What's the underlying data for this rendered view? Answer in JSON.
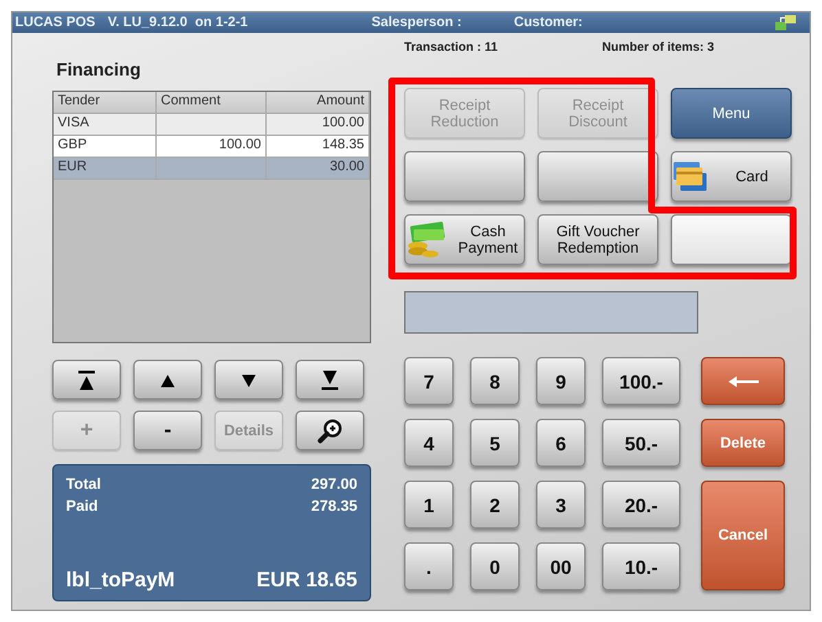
{
  "title_bar": {
    "app": "LUCAS POS",
    "version": "V. LU_9.12.0  on 1-2-1",
    "salesperson": "Salesperson :",
    "customer": "Customer:"
  },
  "financing": {
    "title": "Financing",
    "columns": [
      "Tender",
      "Comment",
      "Amount"
    ],
    "rows": [
      {
        "cells": [
          "VISA",
          "",
          "100.00"
        ],
        "selected": false
      },
      {
        "cells": [
          "GBP",
          "100.00",
          "148.35"
        ],
        "selected": false
      },
      {
        "cells": [
          "EUR",
          "",
          "30.00"
        ],
        "selected": true
      }
    ]
  },
  "nav_buttons": [
    {
      "kind": "first",
      "disabled": false
    },
    {
      "kind": "up",
      "disabled": false
    },
    {
      "kind": "down",
      "disabled": false
    },
    {
      "kind": "last",
      "disabled": false
    },
    {
      "kind": "text",
      "label": "+",
      "disabled": true
    },
    {
      "kind": "text",
      "label": "-",
      "disabled": false
    },
    {
      "kind": "text",
      "label": "Details",
      "disabled": true
    },
    {
      "kind": "zoom",
      "disabled": false
    }
  ],
  "totals": {
    "rows": [
      {
        "label": "Total",
        "value": "297.00"
      },
      {
        "label": "Paid",
        "value": "278.35"
      }
    ],
    "due_label": "lbl_toPayM",
    "due_value": "EUR 18.65"
  },
  "transaction": "Transaction : 11",
  "item_count": "Number of items: 3",
  "function_buttons": [
    {
      "label": "Receipt\nReduction",
      "kind": "gray",
      "disabled": true
    },
    {
      "label": "Receipt\nDiscount",
      "kind": "gray",
      "disabled": true
    },
    {
      "label": "Menu",
      "kind": "blue",
      "disabled": false
    },
    {
      "kind": "gray",
      "disabled": false
    },
    {
      "kind": "gray",
      "disabled": false
    },
    {
      "label": "Card",
      "kind": "card",
      "disabled": false
    },
    {
      "label": "Cash\nPayment",
      "kind": "cash",
      "disabled": false
    },
    {
      "label": "Gift Voucher\nRedemption",
      "kind": "gray",
      "disabled": false
    },
    {
      "kind": "light",
      "disabled": false
    }
  ],
  "keypad": [
    {
      "label": "7",
      "kind": "gray"
    },
    {
      "label": "8",
      "kind": "gray"
    },
    {
      "label": "9",
      "kind": "gray"
    },
    {
      "label": "100.-",
      "kind": "gray"
    },
    {
      "kind": "back"
    },
    {
      "label": "4",
      "kind": "gray"
    },
    {
      "label": "5",
      "kind": "gray"
    },
    {
      "label": "6",
      "kind": "gray"
    },
    {
      "label": "50.-",
      "kind": "gray"
    },
    {
      "label": "Delete",
      "kind": "red"
    },
    {
      "label": "1",
      "kind": "gray"
    },
    {
      "label": "2",
      "kind": "gray"
    },
    {
      "label": "3",
      "kind": "gray"
    },
    {
      "label": "20.-",
      "kind": "gray"
    },
    {
      "label": "Cancel",
      "kind": "red-tall"
    },
    {
      "label": ".",
      "kind": "gray"
    },
    {
      "label": "0",
      "kind": "gray"
    },
    {
      "label": "00",
      "kind": "gray"
    },
    {
      "label": "10.-",
      "kind": "gray"
    }
  ]
}
